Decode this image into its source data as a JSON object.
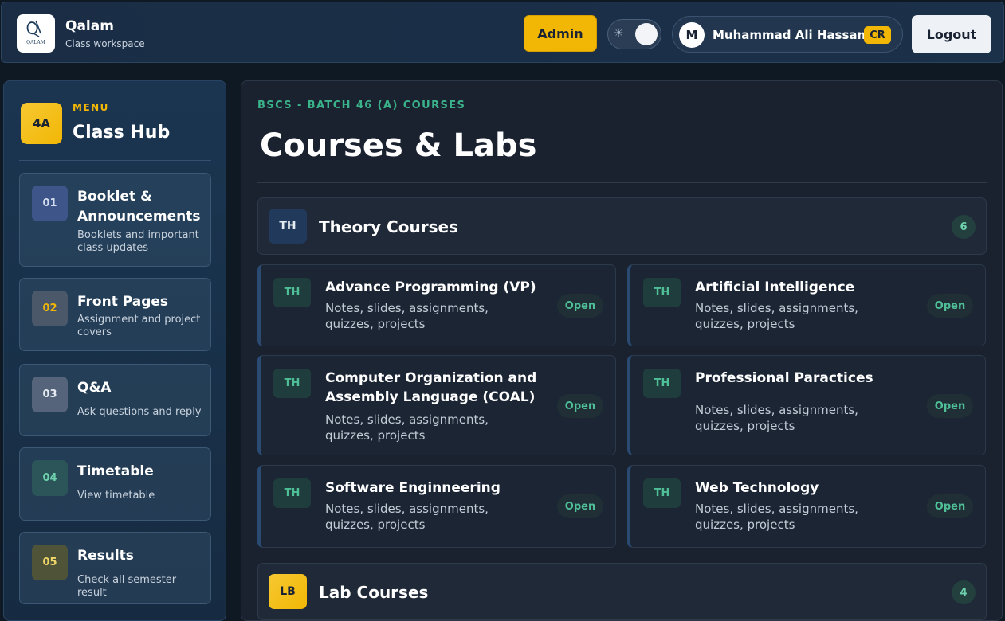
{
  "header": {
    "app_title": "Qalam",
    "app_subtitle": "Class workspace",
    "logo_text": "QALAM",
    "admin_label": "Admin",
    "theme_icon": "sun-icon",
    "user_initial": "M",
    "user_name": "Muhammad Ali Hassan",
    "user_role": "CR",
    "logout_label": "Logout"
  },
  "sidebar": {
    "badge": "4A",
    "menu_label": "MENU",
    "title": "Class Hub",
    "items": [
      {
        "num": "01",
        "title": "Booklet & Announcements",
        "desc": "Booklets and important class updates"
      },
      {
        "num": "02",
        "title": "Front Pages",
        "desc": "Assignment and project covers"
      },
      {
        "num": "03",
        "title": "Q&A",
        "desc": "Ask questions and reply"
      },
      {
        "num": "04",
        "title": "Timetable",
        "desc": "View timetable"
      },
      {
        "num": "05",
        "title": "Results",
        "desc": "Check all semester result"
      }
    ]
  },
  "main": {
    "eyebrow": "BSCS - BATCH 46 (A) COURSES",
    "title": "Courses & Labs",
    "theory": {
      "icon": "TH",
      "title": "Theory Courses",
      "count": "6",
      "courses": [
        {
          "tag": "TH",
          "title": "Advance Programming (VP)",
          "desc": "Notes, slides, assignments, quizzes, projects",
          "action": "Open"
        },
        {
          "tag": "TH",
          "title": "Artificial Intelligence",
          "desc": "Notes, slides, assignments, quizzes, projects",
          "action": "Open"
        },
        {
          "tag": "TH",
          "title": "Computer Organization and Assembly Language (COAL)",
          "desc": "Notes, slides, assignments, quizzes, projects",
          "action": "Open"
        },
        {
          "tag": "TH",
          "title": "Professional Paractices",
          "desc": "Notes, slides, assignments, quizzes, projects",
          "action": "Open"
        },
        {
          "tag": "TH",
          "title": "Software Enginneering",
          "desc": "Notes, slides, assignments, quizzes, projects",
          "action": "Open"
        },
        {
          "tag": "TH",
          "title": "Web Technology",
          "desc": "Notes, slides, assignments, quizzes, projects",
          "action": "Open"
        }
      ]
    },
    "lab": {
      "icon": "LB",
      "title": "Lab Courses",
      "count": "4"
    }
  },
  "colors": {
    "accent_yellow": "#f2b705",
    "accent_green": "#3bb38a",
    "background": "#0f1923",
    "panel": "#1a2230"
  }
}
